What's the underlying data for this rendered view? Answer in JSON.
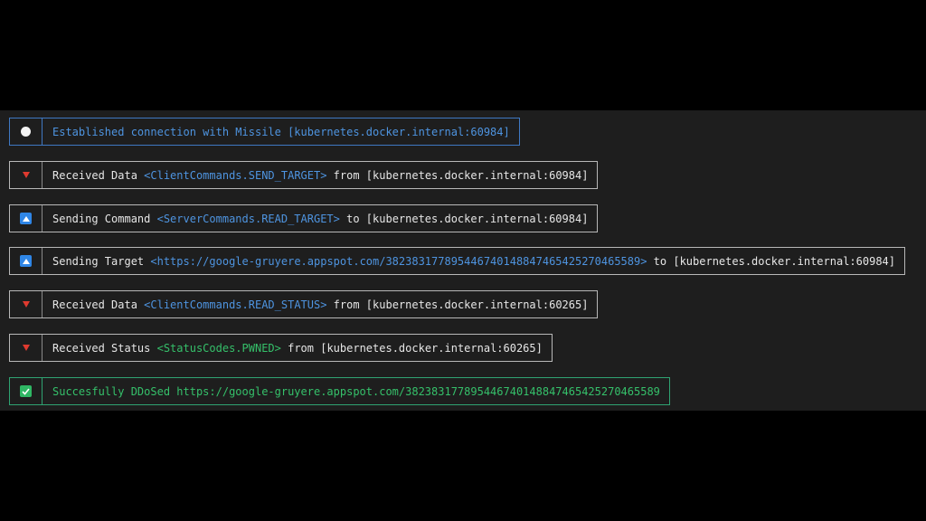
{
  "colors": {
    "background": "#1e1e1e",
    "border": "#b8b8b8",
    "info_blue": "#4e94e0",
    "success_green": "#35c06a",
    "error_red": "#e03a2f"
  },
  "log": [
    {
      "icon": "white-circle-icon",
      "parts": [
        "Established connection with Missile [kubernetes.docker.internal:60984]"
      ]
    },
    {
      "icon": "red-down-triangle-icon",
      "parts": [
        "Received Data ",
        "<ClientCommands.SEND_TARGET>",
        " from [kubernetes.docker.internal:60984]"
      ]
    },
    {
      "icon": "blue-up-arrow-icon",
      "parts": [
        "Sending Command ",
        "<ServerCommands.READ_TARGET>",
        " to [kubernetes.docker.internal:60984]"
      ]
    },
    {
      "icon": "blue-up-arrow-icon",
      "parts": [
        "Sending Target ",
        "<https://google-gruyere.appspot.com/382383177895446740148847465425270465589>",
        " to [kubernetes.docker.internal:60984]"
      ]
    },
    {
      "icon": "red-down-triangle-icon",
      "parts": [
        "Received Data ",
        "<ClientCommands.READ_STATUS>",
        " from [kubernetes.docker.internal:60265]"
      ]
    },
    {
      "icon": "red-down-triangle-icon",
      "parts": [
        "Received Status ",
        "<StatusCodes.PWNED>",
        " from [kubernetes.docker.internal:60265]"
      ]
    },
    {
      "icon": "green-check-icon",
      "parts": [
        "Succesfully DDoSed https://google-gruyere.appspot.com/382383177895446740148847465425270465589"
      ]
    }
  ]
}
